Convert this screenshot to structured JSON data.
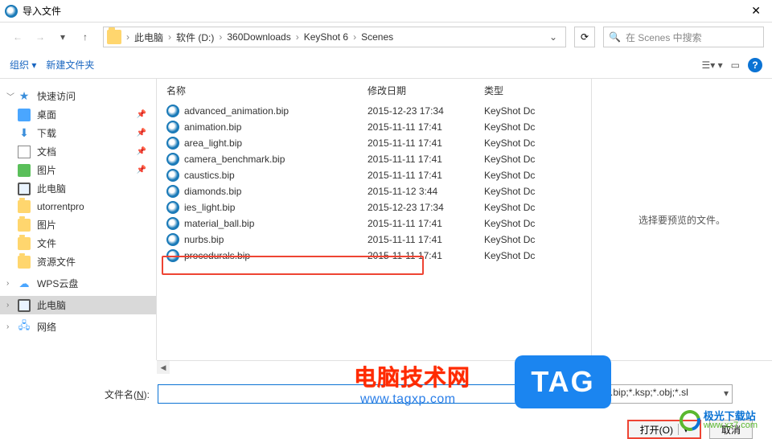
{
  "window": {
    "title": "导入文件",
    "close": "✕"
  },
  "nav": {
    "breadcrumb": [
      "此电脑",
      "软件 (D:)",
      "360Downloads",
      "KeyShot 6",
      "Scenes"
    ],
    "search_placeholder": "在 Scenes 中搜索"
  },
  "toolbar": {
    "organize": "组织",
    "new_folder": "新建文件夹"
  },
  "sidebar": {
    "quick_access": "快速访问",
    "desktop": "桌面",
    "downloads": "下载",
    "documents": "文档",
    "pictures": "图片",
    "this_pc": "此电脑",
    "utorrent": "utorrentpro",
    "pictures2": "图片",
    "files": "文件",
    "resources": "资源文件",
    "wps": "WPS云盘",
    "this_pc2": "此电脑",
    "network": "网络"
  },
  "columns": {
    "name": "名称",
    "modified": "修改日期",
    "type": "类型"
  },
  "files": [
    {
      "name": "advanced_animation.bip",
      "date": "2015-12-23 17:34",
      "type": "KeyShot Dc"
    },
    {
      "name": "animation.bip",
      "date": "2015-11-11 17:41",
      "type": "KeyShot Dc"
    },
    {
      "name": "area_light.bip",
      "date": "2015-11-11 17:41",
      "type": "KeyShot Dc"
    },
    {
      "name": "camera_benchmark.bip",
      "date": "2015-11-11 17:41",
      "type": "KeyShot Dc"
    },
    {
      "name": "caustics.bip",
      "date": "2015-11-11 17:41",
      "type": "KeyShot Dc"
    },
    {
      "name": "diamonds.bip",
      "date": "2015-11-12 3:44",
      "type": "KeyShot Dc"
    },
    {
      "name": "ies_light.bip",
      "date": "2015-12-23 17:34",
      "type": "KeyShot Dc"
    },
    {
      "name": "material_ball.bip",
      "date": "2015-11-11 17:41",
      "type": "KeyShot Dc"
    },
    {
      "name": "nurbs.bip",
      "date": "2015-11-11 17:41",
      "type": "KeyShot Dc"
    },
    {
      "name": "procedurals.bip",
      "date": "2015-11-11 17:41",
      "type": "KeyShot Dc"
    }
  ],
  "preview_text": "选择要预览的文件。",
  "bottom": {
    "filename_label_pre": "文件名(",
    "filename_label_u": "N",
    "filename_label_post": "):",
    "filter": "格式 (*.bip;*.ksp;*.obj;*.sl",
    "open": "打开(O)",
    "cancel": "取消"
  },
  "overlays": {
    "site1_cn": "电脑技术网",
    "site1_url": "www.tagxp.com",
    "tag": "TAG",
    "site2_cn": "极光下载站",
    "site2_url": "www.xz7.com"
  }
}
